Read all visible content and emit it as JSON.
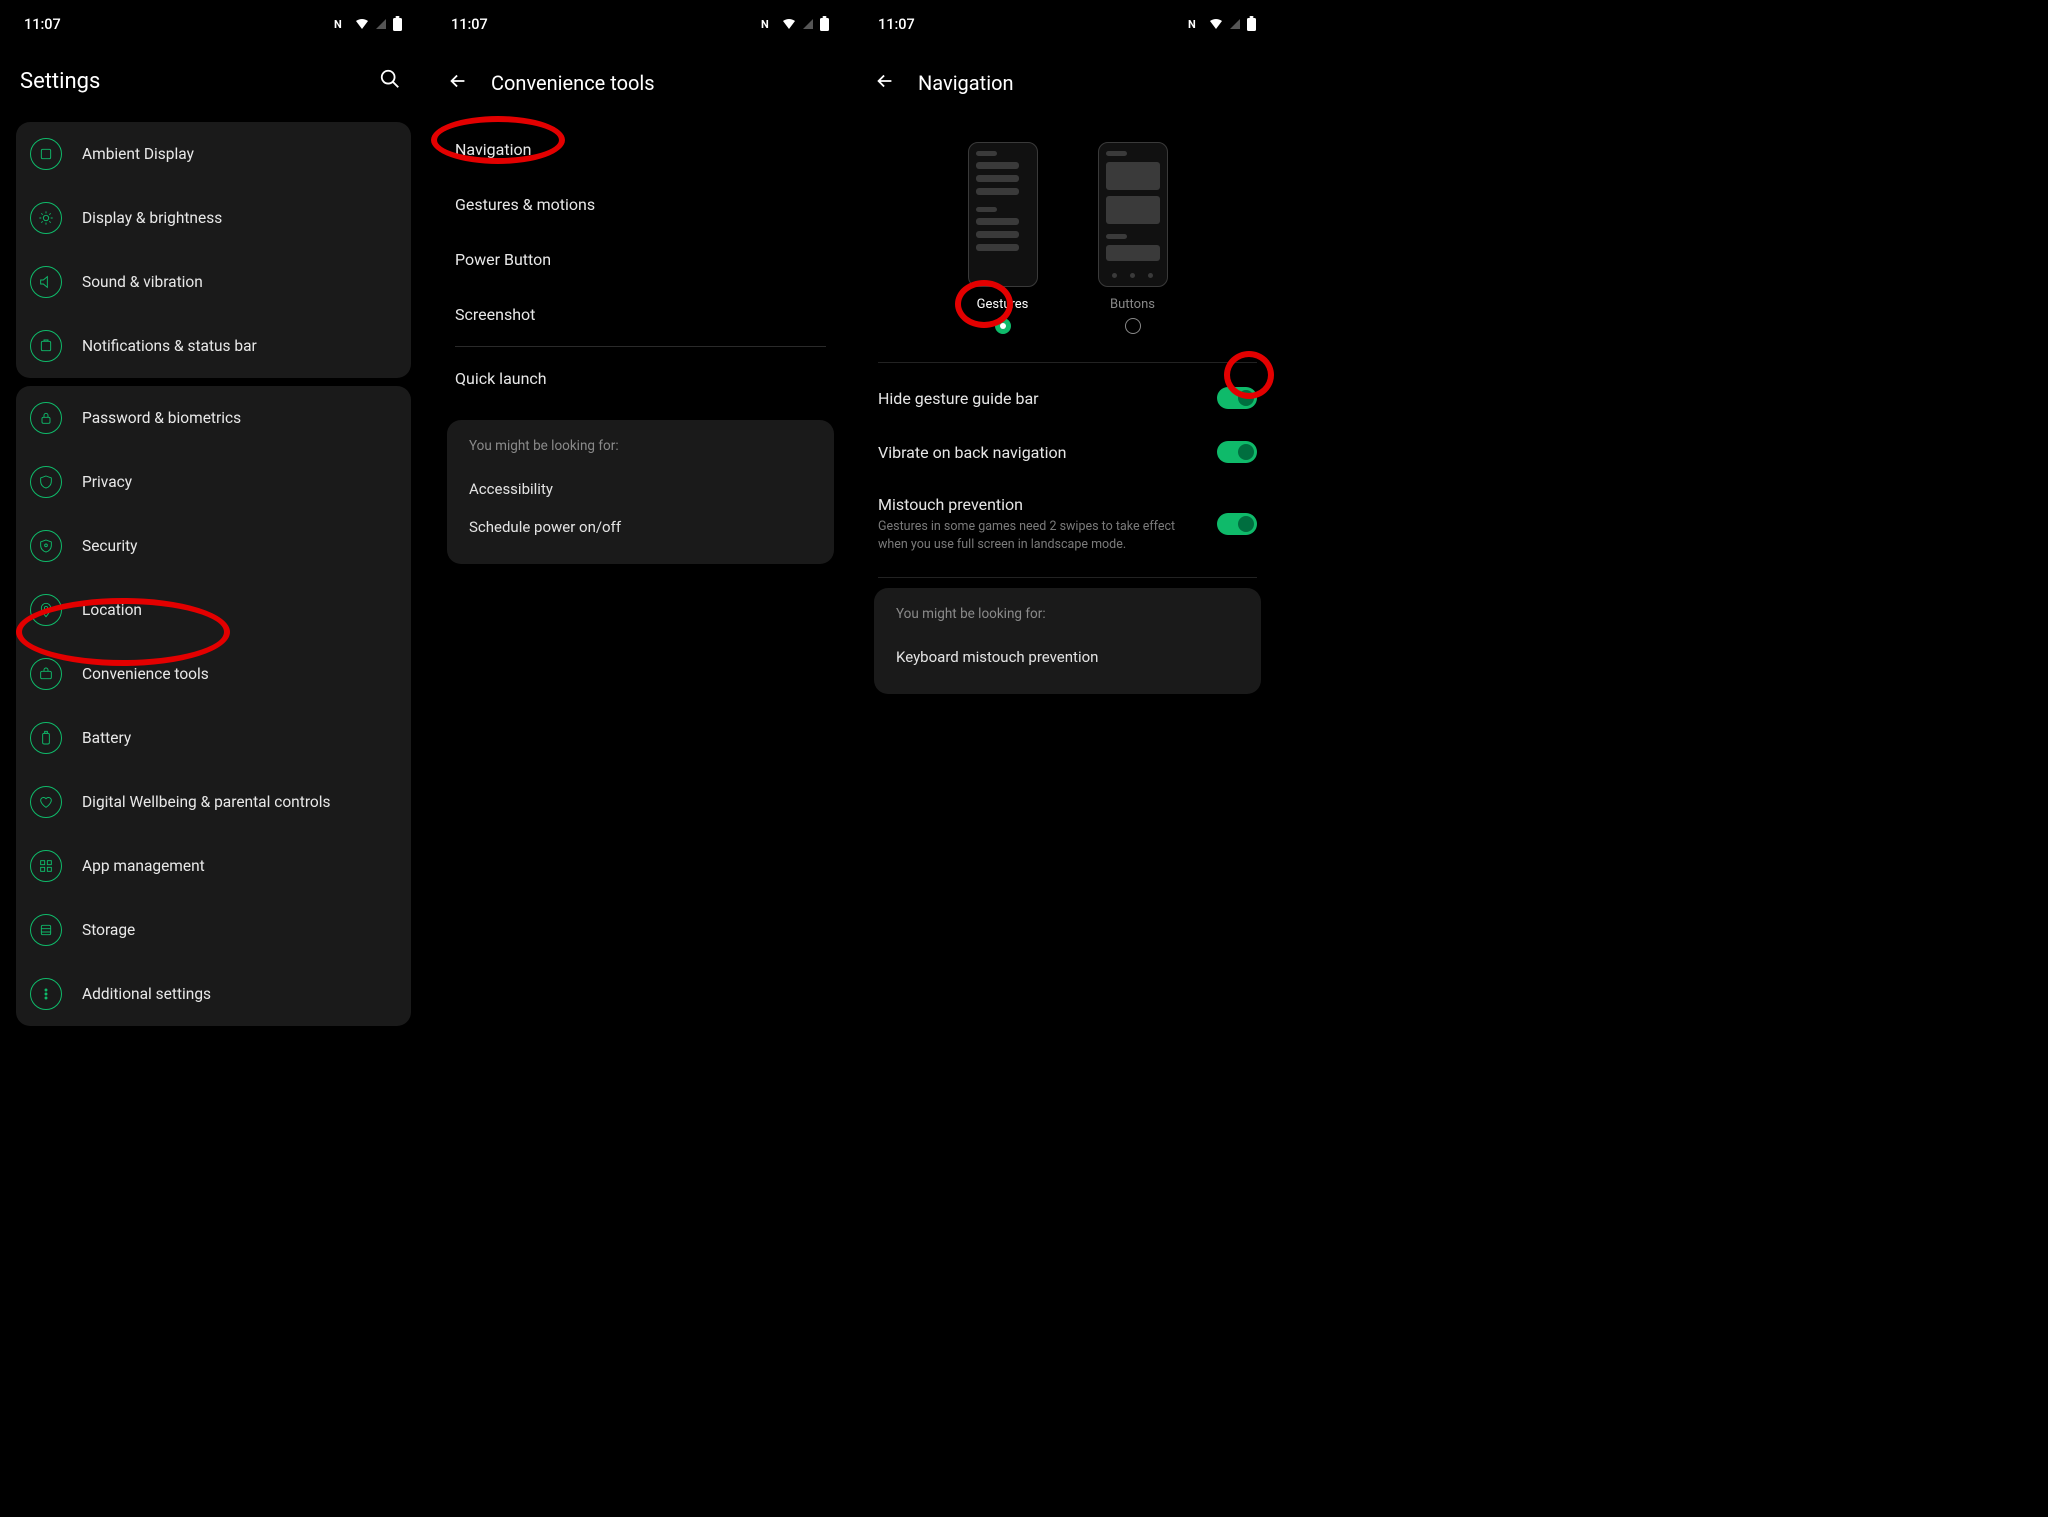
{
  "status": {
    "time": "11:07"
  },
  "screen1": {
    "title": "Settings",
    "group1": [
      {
        "icon": "ambient",
        "label": "Ambient Display"
      },
      {
        "icon": "bright",
        "label": "Display & brightness"
      },
      {
        "icon": "sound",
        "label": "Sound & vibration"
      },
      {
        "icon": "notif",
        "label": "Notifications & status bar"
      }
    ],
    "group2": [
      {
        "icon": "lock",
        "label": "Password & biometrics"
      },
      {
        "icon": "privacy",
        "label": "Privacy"
      },
      {
        "icon": "security",
        "label": "Security"
      },
      {
        "icon": "location",
        "label": "Location"
      },
      {
        "icon": "tools",
        "label": "Convenience tools",
        "highlight": true
      },
      {
        "icon": "battery",
        "label": "Battery"
      },
      {
        "icon": "heart",
        "label": "Digital Wellbeing & parental controls"
      },
      {
        "icon": "apps",
        "label": "App management"
      },
      {
        "icon": "storage",
        "label": "Storage"
      },
      {
        "icon": "more",
        "label": "Additional settings"
      }
    ]
  },
  "screen2": {
    "title": "Convenience tools",
    "items": [
      {
        "label": "Navigation",
        "highlight": true
      },
      {
        "label": "Gestures & motions"
      },
      {
        "label": "Power Button"
      },
      {
        "label": "Screenshot"
      }
    ],
    "quick": "Quick launch",
    "suggest": {
      "title": "You might be looking for:",
      "items": [
        "Accessibility",
        "Schedule power on/off"
      ]
    }
  },
  "screen3": {
    "title": "Navigation",
    "options": [
      {
        "label": "Gestures",
        "selected": true
      },
      {
        "label": "Buttons",
        "selected": false
      }
    ],
    "toggles": [
      {
        "title": "Hide gesture guide bar",
        "on": true,
        "highlight": true
      },
      {
        "title": "Vibrate on back navigation",
        "on": true
      },
      {
        "title": "Mistouch prevention",
        "sub": "Gestures in some games need 2 swipes to take effect when you use full screen in landscape mode.",
        "on": true
      }
    ],
    "suggest": {
      "title": "You might be looking for:",
      "items": [
        "Keyboard mistouch prevention"
      ]
    }
  }
}
